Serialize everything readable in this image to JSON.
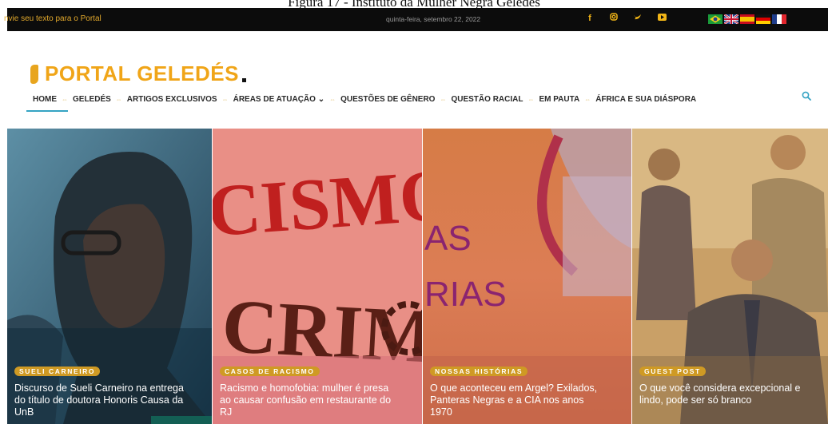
{
  "caption": "Figura 17 - Instituto da Mulher Negra Geledés",
  "topbar": {
    "left_text": "nvie seu texto para o Portal",
    "date": "quinta-feira, setembro 22, 2022",
    "social_icons": [
      "facebook-icon",
      "instagram-icon",
      "twitter-icon",
      "youtube-icon"
    ],
    "flags": [
      "brazil-flag",
      "uk-flag",
      "spain-flag",
      "germany-flag",
      "france-flag"
    ]
  },
  "logo": {
    "text": "PORTAL GELEDÉS"
  },
  "nav": {
    "items": [
      "HOME",
      "GELEDÉS",
      "ARTIGOS EXCLUSIVOS",
      "ÁREAS DE ATUAÇÃO",
      "QUESTÕES DE GÊNERO",
      "QUESTÃO RACIAL",
      "EM PAUTA",
      "ÁFRICA E SUA DIÁSPORA"
    ],
    "dropdown_glyph": "⌄"
  },
  "cards": [
    {
      "tag": "SUELI CARNEIRO",
      "title": "Discurso de Sueli Carneiro na entrega do título de doutora Honoris Causa da UnB"
    },
    {
      "tag": "CASOS DE RACISMO",
      "title": "Racismo e homofobia: mulher é presa ao causar confusão em restaurante do RJ",
      "art_text_1": "CISMO",
      "art_text_2": "CRIME"
    },
    {
      "tag": "NOSSAS HISTÓRIAS",
      "title": "O que aconteceu em Argel? Exilados, Panteras Negras e a CIA nos anos 1970",
      "art_text_1": "AS",
      "art_text_2": "RIAS"
    },
    {
      "tag": "GUEST POST",
      "title": "O que você considera excepcional e lindo, pode ser só branco"
    }
  ],
  "colors": {
    "accent": "#f0a518",
    "nav_active": "#35a3c3",
    "topbar_bg": "#0c0c0c"
  }
}
